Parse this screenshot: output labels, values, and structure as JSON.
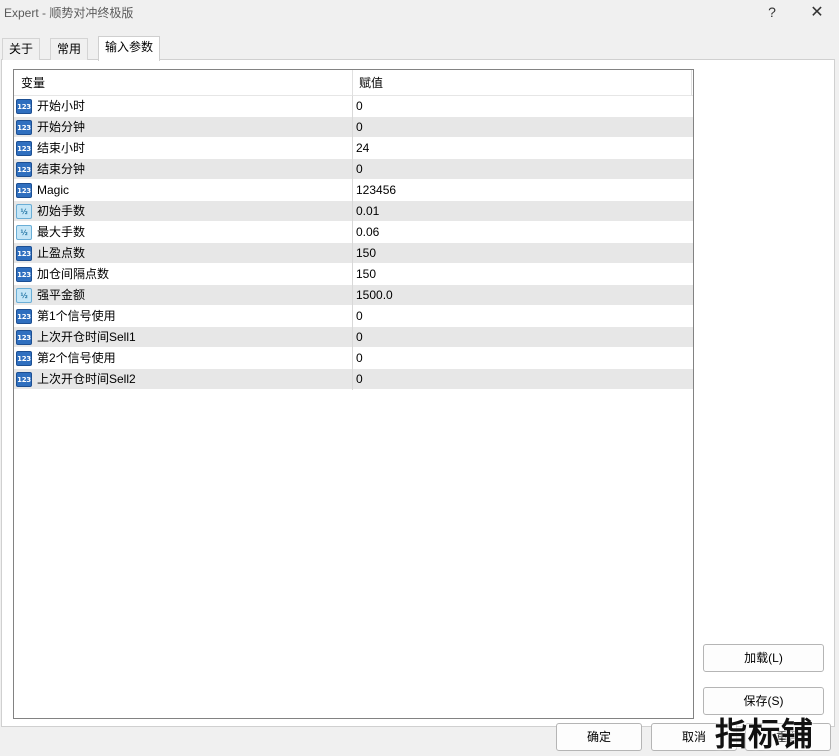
{
  "window": {
    "title": "Expert - 顺势对冲终极版",
    "help_label": "?",
    "close_label": "✕"
  },
  "tabs": [
    {
      "label": "关于"
    },
    {
      "label": "常用"
    },
    {
      "label": "输入参数",
      "active": true
    }
  ],
  "grid": {
    "headers": {
      "variable": "变量",
      "value": "赋值"
    },
    "rows": [
      {
        "icon": "int-icon",
        "name": "开始小时",
        "value": "0"
      },
      {
        "icon": "int-icon",
        "name": "开始分钟",
        "value": "0"
      },
      {
        "icon": "int-icon",
        "name": "结束小时",
        "value": "24"
      },
      {
        "icon": "int-icon",
        "name": "结束分钟",
        "value": "0"
      },
      {
        "icon": "int-icon",
        "name": "Magic",
        "value": "123456"
      },
      {
        "icon": "double-icon",
        "name": "初始手数",
        "value": "0.01"
      },
      {
        "icon": "double-icon",
        "name": "最大手数",
        "value": "0.06"
      },
      {
        "icon": "int-icon",
        "name": "止盈点数",
        "value": "150"
      },
      {
        "icon": "int-icon",
        "name": "加仓间隔点数",
        "value": "150"
      },
      {
        "icon": "double-icon",
        "name": "强平金额",
        "value": "1500.0"
      },
      {
        "icon": "int-icon",
        "name": "第1个信号使用",
        "value": "0"
      },
      {
        "icon": "int-icon",
        "name": "上次开仓时间Sell1",
        "value": "0"
      },
      {
        "icon": "int-icon",
        "name": "第2个信号使用",
        "value": "0"
      },
      {
        "icon": "int-icon",
        "name": "上次开仓时间Sell2",
        "value": "0"
      }
    ]
  },
  "icons": {
    "int_glyph": "123",
    "double_glyph": "½"
  },
  "buttons": {
    "load": "加载(L)",
    "save": "保存(S)",
    "ok": "确定",
    "cancel": "取消",
    "reset": "重置"
  },
  "watermark": "指标铺"
}
